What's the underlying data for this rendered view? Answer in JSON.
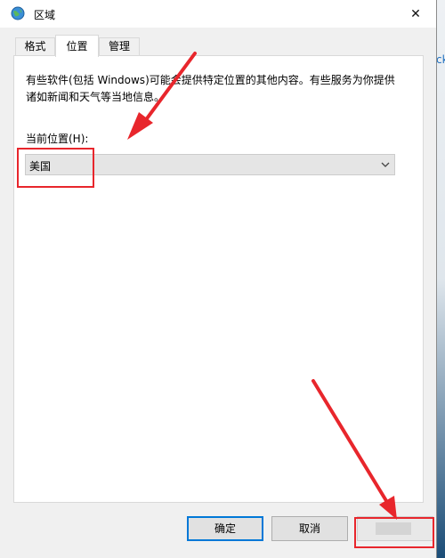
{
  "window": {
    "title": "区域",
    "close_glyph": "✕"
  },
  "desktop": {
    "edge_text": "ck"
  },
  "tabs": [
    {
      "label": "格式",
      "active": false
    },
    {
      "label": "位置",
      "active": true
    },
    {
      "label": "管理",
      "active": false
    }
  ],
  "panel": {
    "description_line1": "有些软件(包括 Windows)可能会提供特定位置的其他内容。有些服务为你提供",
    "description_line2": "诸如新闻和天气等当地信息。",
    "location_label": "当前位置(H):",
    "location_value": "美国"
  },
  "buttons": {
    "ok": "确定",
    "cancel": "取消"
  },
  "colors": {
    "annotation_red": "#e8262c",
    "focus_blue": "#0078d7"
  },
  "icons": {
    "title": "globe-icon",
    "close": "close-icon",
    "dropdown": "chevron-down-icon"
  }
}
